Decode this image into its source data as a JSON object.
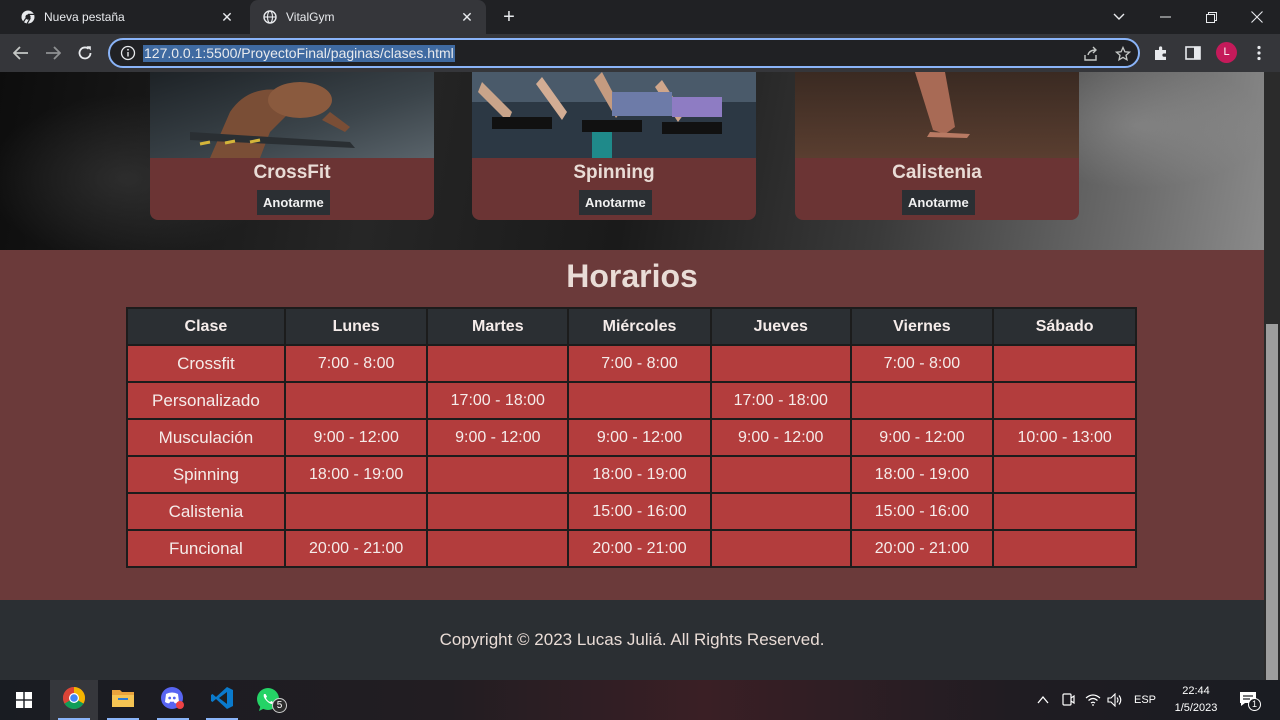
{
  "browser": {
    "tabs": [
      {
        "title": "Nueva pestaña",
        "icon": "chrome-icon",
        "active": false
      },
      {
        "title": "VitalGym",
        "icon": "globe-icon",
        "active": true
      }
    ],
    "url": "127.0.0.1:5500/ProyectoFinal/paginas/clases.html",
    "profile_initial": "L"
  },
  "classes": {
    "cards": [
      {
        "title": "CrossFit",
        "button": "Anotarme"
      },
      {
        "title": "Spinning",
        "button": "Anotarme"
      },
      {
        "title": "Calistenia",
        "button": "Anotarme"
      }
    ]
  },
  "schedule": {
    "title": "Horarios",
    "headers": [
      "Clase",
      "Lunes",
      "Martes",
      "Miércoles",
      "Jueves",
      "Viernes",
      "Sábado"
    ],
    "rows": [
      [
        "Crossfit",
        "7:00 - 8:00",
        "",
        "7:00 - 8:00",
        "",
        "7:00 - 8:00",
        ""
      ],
      [
        "Personalizado",
        "",
        "17:00 - 18:00",
        "",
        "17:00 - 18:00",
        "",
        ""
      ],
      [
        "Musculación",
        "9:00 - 12:00",
        "9:00 - 12:00",
        "9:00 - 12:00",
        "9:00 - 12:00",
        "9:00 - 12:00",
        "10:00 - 13:00"
      ],
      [
        "Spinning",
        "18:00 - 19:00",
        "",
        "18:00 - 19:00",
        "",
        "18:00 - 19:00",
        ""
      ],
      [
        "Calistenia",
        "",
        "",
        "15:00 - 16:00",
        "",
        "15:00 - 16:00",
        ""
      ],
      [
        "Funcional",
        "20:00 - 21:00",
        "",
        "20:00 - 21:00",
        "",
        "20:00 - 21:00",
        ""
      ]
    ]
  },
  "footer": {
    "copyright": "Copyright © 2023 Lucas Juliá. All Rights Reserved."
  },
  "taskbar": {
    "apps": [
      "chrome-icon",
      "file-explorer-icon",
      "discord-icon",
      "vscode-icon",
      "whatsapp-icon"
    ],
    "whatsapp_badge": "5",
    "language": "ESP",
    "time": "22:44",
    "date": "1/5/2023",
    "notification_count": "1"
  },
  "colors": {
    "accent": "#8ab4f8",
    "table_cell": "#b33d3d",
    "section_bg": "#6b3a3a",
    "dark": "#2b2f33"
  }
}
